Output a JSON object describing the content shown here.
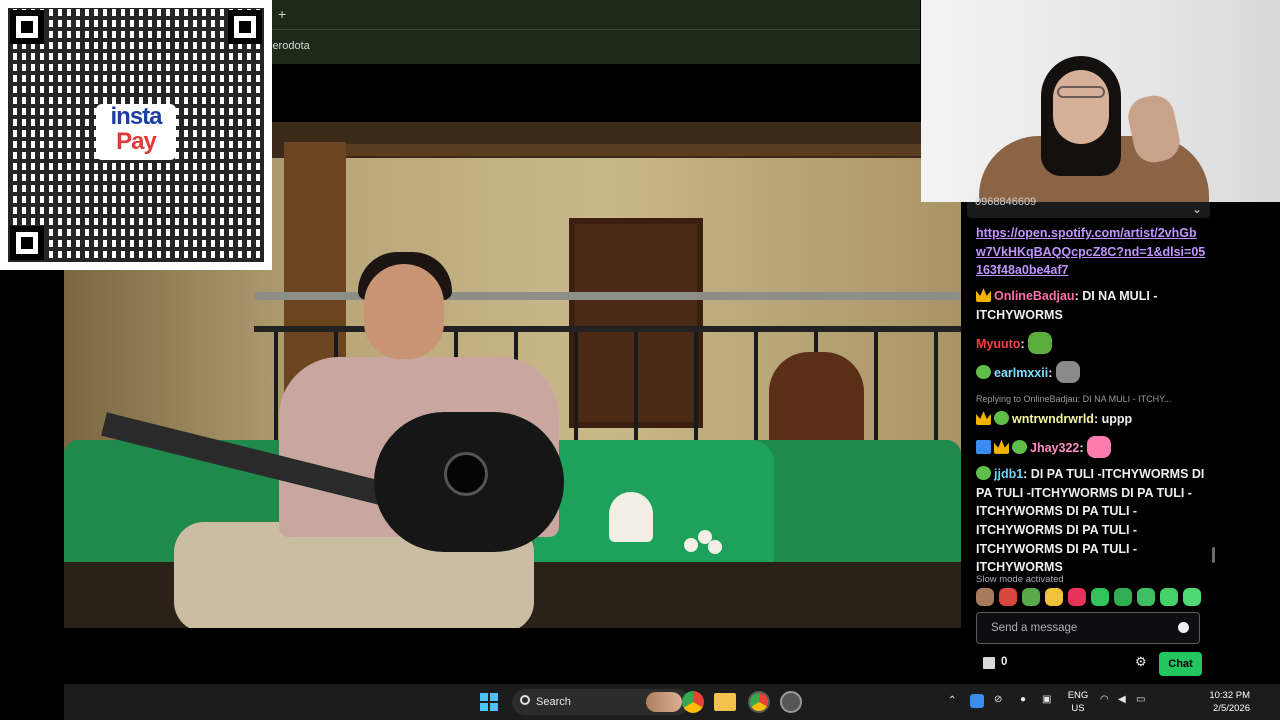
{
  "browser": {
    "new_tab_glyph": "+",
    "address_text": "lerodota"
  },
  "qr_overlay": {
    "logo_line1": "insta",
    "logo_line2": "Pay"
  },
  "chat": {
    "top_bar_text": "0968846609",
    "link_message": {
      "text": "https://open.spotify.com/artist/2vhGbw7VkHKqBAQQcpcZ8C?nd=1&dlsi=05163f48a0be4af7",
      "color": "#bf94ff"
    },
    "messages": [
      {
        "user": "OnlineBadjau",
        "user_color": "#ff6fa8",
        "text": ": DI NA MULI - ITCHYWORMS"
      },
      {
        "user": "Myuuto",
        "user_color": "#ff3b3b",
        "text": ":"
      },
      {
        "user": "earlmxxii",
        "user_color": "#7ee0ff",
        "text": ":"
      },
      {
        "reply_text": "Replying to OnlineBadjau: DI NA MULI - ITCHY...",
        "user": "wntrwndrwrld",
        "user_color": "#f4f3a0",
        "text": ": uppp"
      },
      {
        "user": "Jhay322",
        "user_color": "#ff8fbf",
        "text": ":"
      },
      {
        "user": "jjdb1",
        "user_color": "#6bd3ff",
        "text": ": DI PA TULI -ITCHYWORMS DI PA TULI -ITCHYWORMS DI PA TULI - ITCHYWORMS DI PA TULI - ITCHYWORMS DI PA TULI - ITCHYWORMS DI PA TULI - ITCHYWORMS"
      }
    ],
    "slow_mode_text": "Slow mode activated",
    "input_placeholder": "Send a message",
    "points_count": "0",
    "chat_button_label": "Chat",
    "chat_button_color": "#22c55e"
  },
  "taskbar": {
    "search_label": "Search",
    "lang_line1": "ENG",
    "lang_line2": "US",
    "time": "10:32 PM",
    "date": "2/5/2026"
  }
}
